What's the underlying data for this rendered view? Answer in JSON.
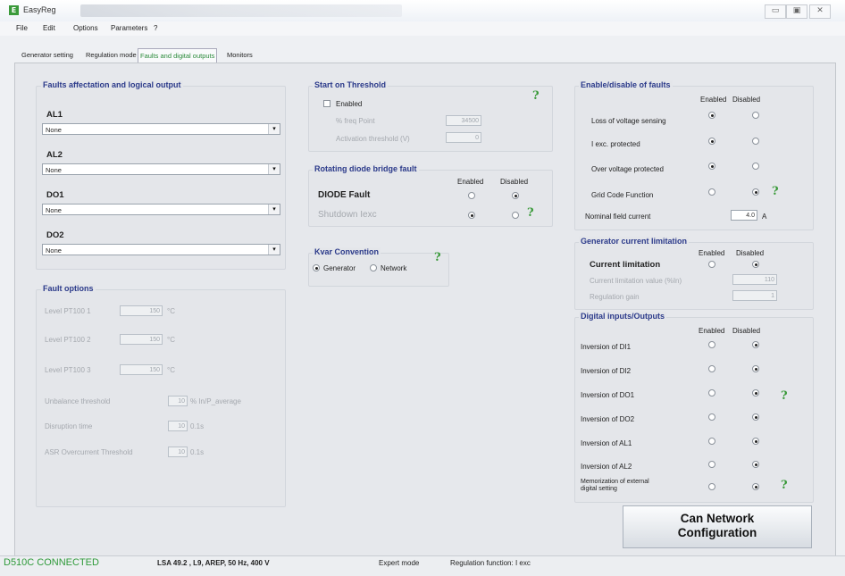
{
  "window": {
    "title": "EasyReg",
    "icon": "app-icon",
    "buttons": [
      "▭",
      "▣",
      "✕"
    ]
  },
  "menu": [
    "File",
    "Edit",
    "Options",
    "Parameters",
    "?"
  ],
  "tabs": [
    {
      "label": "Generator setting",
      "active": false
    },
    {
      "label": "Regulation mode",
      "active": false
    },
    {
      "label": "Faults and digital outputs",
      "active": true
    },
    {
      "label": "Monitors",
      "active": false
    }
  ],
  "faults_affectation": {
    "title": "Faults affectation and logical output",
    "rows": [
      {
        "label": "AL1",
        "value": "None"
      },
      {
        "label": "AL2",
        "value": "None"
      },
      {
        "label": "DO1",
        "value": "None"
      },
      {
        "label": "DO2",
        "value": "None"
      }
    ]
  },
  "fault_options": {
    "title": "Fault options",
    "rows": [
      {
        "label": "Level PT100 1",
        "value": "150",
        "unit": "°C"
      },
      {
        "label": "Level PT100 2",
        "value": "150",
        "unit": "°C"
      },
      {
        "label": "Level PT100 3",
        "value": "150",
        "unit": "°C"
      },
      {
        "label": "Unbalance threshold",
        "value": "10",
        "unit": "% In/P_average"
      },
      {
        "label": "Disruption time",
        "value": "10",
        "unit": "0.1s"
      },
      {
        "label": "ASR Overcurrent Threshold",
        "value": "10",
        "unit": "0.1s"
      }
    ]
  },
  "start_threshold": {
    "title": "Start on Threshold",
    "enabled_label": "Enabled",
    "rows": [
      {
        "label": "% freq Point",
        "value": "34500"
      },
      {
        "label": "Activation threshold (V)",
        "value": "0"
      }
    ]
  },
  "diode": {
    "title": "Rotating diode bridge fault",
    "col_enabled": "Enabled",
    "col_disabled": "Disabled",
    "rows": [
      {
        "label": "DIODE Fault",
        "enabled": false,
        "disabled": true
      },
      {
        "label": "Shutdown Iexc",
        "enabled": true,
        "disabled": false
      }
    ]
  },
  "kvar": {
    "title": "Kvar Convention",
    "options": [
      "Generator",
      "Network"
    ],
    "selected": "Generator"
  },
  "enable_faults": {
    "title": "Enable/disable of faults",
    "col_enabled": "Enabled",
    "col_disabled": "Disabled",
    "rows": [
      {
        "label": "Loss of voltage sensing",
        "enabled": true,
        "help": false
      },
      {
        "label": "I exc. protected",
        "enabled": true,
        "help": false
      },
      {
        "label": "Over voltage protected",
        "enabled": true,
        "help": false
      },
      {
        "label": "Grid Code Function",
        "enabled": false,
        "help": true
      }
    ],
    "nominal_label": "Nominal field current",
    "nominal_value": "4.0",
    "nominal_unit": "A"
  },
  "current_limitation": {
    "title": "Generator current limitation",
    "col_enabled": "Enabled",
    "col_disabled": "Disabled",
    "label": "Current limitation",
    "enabled": false,
    "rows": [
      {
        "label": "Current limitation value (%In)",
        "value": "110"
      },
      {
        "label": "Regulation gain",
        "value": "1"
      }
    ]
  },
  "digital_io": {
    "title": "Digital inputs/Outputs",
    "col_enabled": "Enabled",
    "col_disabled": "Disabled",
    "rows": [
      {
        "label": "Inversion of DI1",
        "enabled": false,
        "help": false
      },
      {
        "label": "Inversion of DI2",
        "enabled": false,
        "help": false
      },
      {
        "label": "Inversion of DO1",
        "enabled": false,
        "help": true
      },
      {
        "label": "Inversion of DO2",
        "enabled": false,
        "help": false
      },
      {
        "label": "Inversion of AL1",
        "enabled": false,
        "help": false
      },
      {
        "label": "Inversion of AL2",
        "enabled": false,
        "help": false
      },
      {
        "label": "Memorization of external digital setting",
        "enabled": false,
        "help": true
      }
    ]
  },
  "can_button": "Can Network Configuration",
  "status": {
    "connection": "D510C CONNECTED",
    "machine": "LSA 49.2 , L9, AREP, 50 Hz, 400 V",
    "mode": "Expert mode",
    "regulation": "Regulation function: I exc"
  },
  "help_glyph": "?",
  "dropdown_glyph": "▾",
  "colors": {
    "accent_green": "#3a9a3a",
    "group_title": "#2b3a8a"
  }
}
